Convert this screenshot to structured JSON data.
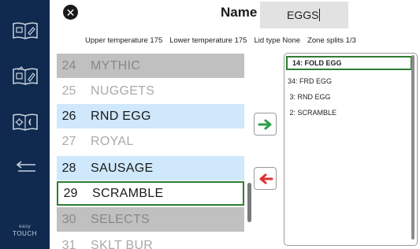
{
  "sidebar": {
    "items": [
      {
        "icon": "recipe-book-icon"
      },
      {
        "icon": "recipe-book-edit-icon"
      },
      {
        "icon": "settings-book-icon"
      },
      {
        "icon": "back-arrow-icon"
      }
    ],
    "brand_line1": "easy",
    "brand_line2": "TOUCH"
  },
  "header": {
    "close_icon": "close-icon",
    "name_label": "Name",
    "name_value": "EGGS"
  },
  "info": {
    "upper_temperature": "Upper temperature 175",
    "lower_temperature": "Lower temperature 175",
    "lid_type": "Lid type None",
    "zone_splits": "Zone splits 1/3"
  },
  "products": [
    {
      "num": "24",
      "label": "MYTHIC",
      "state": "gray"
    },
    {
      "num": "25",
      "label": "NUGGETS",
      "state": "white"
    },
    {
      "num": "26",
      "label": "RND EGG",
      "state": "blue"
    },
    {
      "num": "27",
      "label": "ROYAL",
      "state": "white"
    },
    {
      "num": "28",
      "label": "SAUSAGE",
      "state": "blue"
    },
    {
      "num": "29",
      "label": "SCRAMBLE",
      "state": "selected"
    },
    {
      "num": "30",
      "label": "SELECTS",
      "state": "gray"
    },
    {
      "num": "31",
      "label": "SKLT BUR",
      "state": "white"
    }
  ],
  "actions": {
    "add_icon": "arrow-right-icon",
    "remove_icon": "arrow-left-icon",
    "add_color": "#2e9e4a",
    "remove_color": "#e03030"
  },
  "zone_list": [
    "14: FOLD EGG",
    "34: FRD EGG",
    " 3: RND EGG",
    " 2: SCRAMBLE"
  ]
}
